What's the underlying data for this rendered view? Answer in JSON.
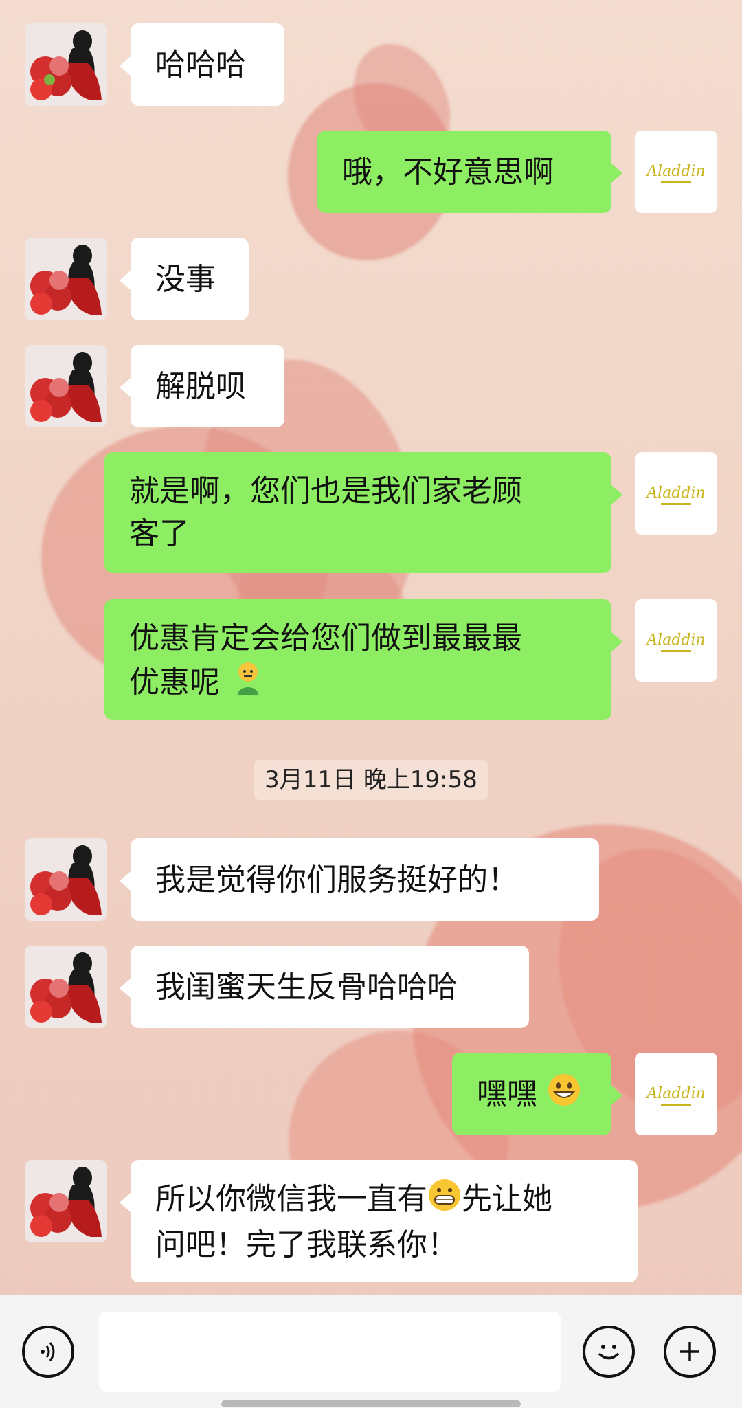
{
  "messages": [
    {
      "side": "left",
      "text": "哈哈哈"
    },
    {
      "side": "right",
      "text": "哦，不好意思啊"
    },
    {
      "side": "left",
      "text": "没事"
    },
    {
      "side": "left",
      "text": "解脱呗"
    },
    {
      "side": "right",
      "line1": "就是啊，您们也是我们家老顾",
      "line2": "客了"
    },
    {
      "side": "right",
      "line1": "优惠肯定会给您们做到最最最",
      "line2": "优惠呢",
      "emoji": "man-emoji"
    },
    {
      "side": "left",
      "text": "我是觉得你们服务挺好的！"
    },
    {
      "side": "left",
      "text": "我闺蜜天生反骨哈哈哈"
    },
    {
      "side": "right",
      "text": "嘿嘿",
      "emoji": "grinning-face-emoji"
    },
    {
      "side": "left",
      "line1a": "所以你微信我一直有",
      "emoji": "grimacing-face-emoji",
      "line1b": "先让她",
      "line2": "问吧！完了我联系你！"
    }
  ],
  "timestamp": "3月11日 晚上19:58",
  "avatar_right": {
    "brand_text": "Aladdin"
  },
  "input_bar": {
    "voice_icon": "voice-icon",
    "emoji_icon": "emoji-icon",
    "plus_icon": "plus-icon",
    "placeholder": ""
  },
  "colors": {
    "outgoing_bubble": "#8ded63",
    "incoming_bubble": "#ffffff"
  }
}
